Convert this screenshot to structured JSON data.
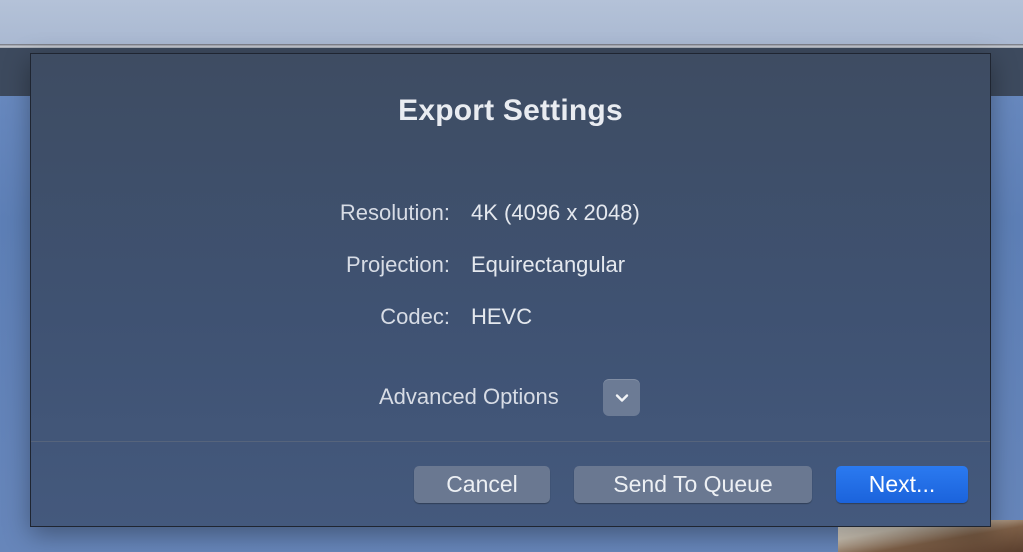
{
  "dialog": {
    "title": "Export Settings",
    "info": [
      {
        "label": "Resolution:",
        "value": "4K (4096 x 2048)"
      },
      {
        "label": "Projection:",
        "value": "Equirectangular"
      },
      {
        "label": "Codec:",
        "value": "HEVC"
      }
    ],
    "advanced_options_label": "Advanced Options",
    "advanced_toggle_icon": "chevron-down-icon",
    "buttons": {
      "cancel": "Cancel",
      "send_to_queue": "Send To Queue",
      "next": "Next..."
    }
  },
  "colors": {
    "primary_button": "#1f6ce6",
    "secondary_button": "#6a7891",
    "dialog_background": "#3f5272"
  }
}
